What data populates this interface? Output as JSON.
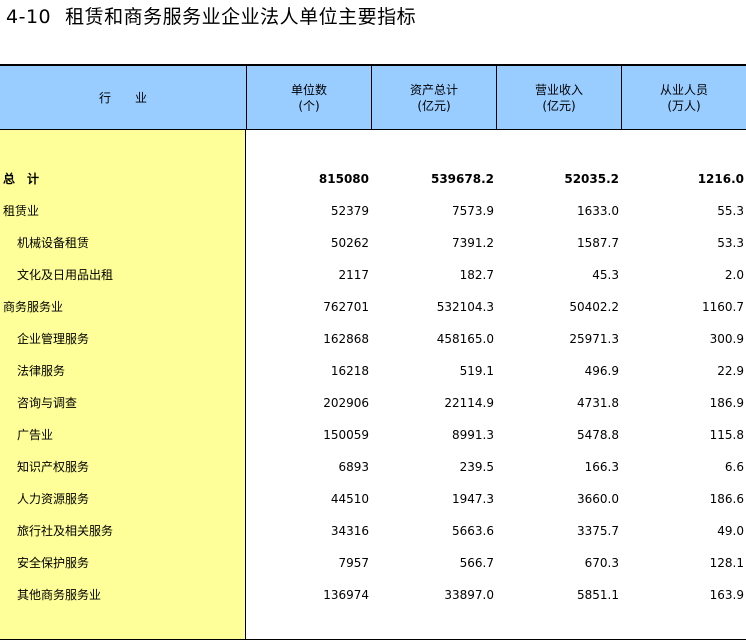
{
  "title": {
    "number": "4-10",
    "text": "租赁和商务服务业企业法人单位主要指标"
  },
  "header": {
    "industry": "行　　业",
    "columns": [
      {
        "line1": "单位数",
        "line2": "(个)"
      },
      {
        "line1": "资产总计",
        "line2": "(亿元)"
      },
      {
        "line1": "营业收入",
        "line2": "(亿元)"
      },
      {
        "line1": "从业人员",
        "line2": "(万人)"
      }
    ]
  },
  "rows": [
    {
      "label": "总　计",
      "level": 0,
      "bold": true,
      "values": [
        "815080",
        "539678.2",
        "52035.2",
        "1216.0"
      ]
    },
    {
      "label": "租赁业",
      "level": 0,
      "bold": false,
      "values": [
        "52379",
        "7573.9",
        "1633.0",
        "55.3"
      ]
    },
    {
      "label": "机械设备租赁",
      "level": 1,
      "bold": false,
      "values": [
        "50262",
        "7391.2",
        "1587.7",
        "53.3"
      ]
    },
    {
      "label": "文化及日用品出租",
      "level": 1,
      "bold": false,
      "values": [
        "2117",
        "182.7",
        "45.3",
        "2.0"
      ]
    },
    {
      "label": "商务服务业",
      "level": 0,
      "bold": false,
      "values": [
        "762701",
        "532104.3",
        "50402.2",
        "1160.7"
      ]
    },
    {
      "label": "企业管理服务",
      "level": 1,
      "bold": false,
      "values": [
        "162868",
        "458165.0",
        "25971.3",
        "300.9"
      ]
    },
    {
      "label": "法律服务",
      "level": 1,
      "bold": false,
      "values": [
        "16218",
        "519.1",
        "496.9",
        "22.9"
      ]
    },
    {
      "label": "咨询与调查",
      "level": 1,
      "bold": false,
      "values": [
        "202906",
        "22114.9",
        "4731.8",
        "186.9"
      ]
    },
    {
      "label": "广告业",
      "level": 1,
      "bold": false,
      "values": [
        "150059",
        "8991.3",
        "5478.8",
        "115.8"
      ]
    },
    {
      "label": "知识产权服务",
      "level": 1,
      "bold": false,
      "values": [
        "6893",
        "239.5",
        "166.3",
        "6.6"
      ]
    },
    {
      "label": "人力资源服务",
      "level": 1,
      "bold": false,
      "values": [
        "44510",
        "1947.3",
        "3660.0",
        "186.6"
      ]
    },
    {
      "label": "旅行社及相关服务",
      "level": 1,
      "bold": false,
      "values": [
        "34316",
        "5663.6",
        "3375.7",
        "49.0"
      ]
    },
    {
      "label": "安全保护服务",
      "level": 1,
      "bold": false,
      "values": [
        "7957",
        "566.7",
        "670.3",
        "128.1"
      ]
    },
    {
      "label": "其他商务服务业",
      "level": 1,
      "bold": false,
      "values": [
        "136974",
        "33897.0",
        "5851.1",
        "163.9"
      ]
    }
  ]
}
